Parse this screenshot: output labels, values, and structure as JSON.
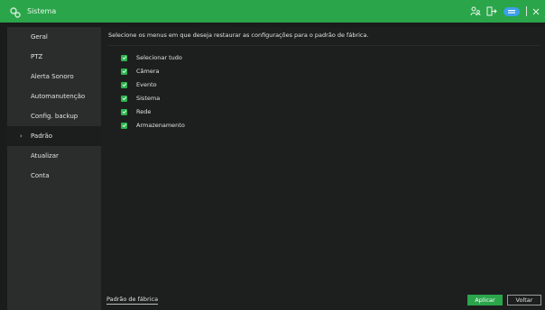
{
  "window": {
    "title": "Sistema"
  },
  "titlebar": {
    "icons": [
      "users-icon",
      "logout-icon",
      "cloud-icon",
      "close-icon"
    ]
  },
  "sidebar": {
    "items": [
      {
        "label": "Geral"
      },
      {
        "label": "PTZ"
      },
      {
        "label": "Alerta Sonoro"
      },
      {
        "label": "Automanutenção"
      },
      {
        "label": "Config. backup"
      },
      {
        "label": "Padrão",
        "active": true
      },
      {
        "label": "Atualizar"
      },
      {
        "label": "Conta"
      }
    ]
  },
  "main": {
    "description": "Selecione os menus em que deseja restaurar as configurações para o padrão de fábrica.",
    "options": [
      {
        "label": "Selecionar tudo",
        "checked": true
      },
      {
        "label": "Câmera",
        "checked": true
      },
      {
        "label": "Evento",
        "checked": true
      },
      {
        "label": "Sistema",
        "checked": true
      },
      {
        "label": "Rede",
        "checked": true
      },
      {
        "label": "Armazenamento",
        "checked": true
      }
    ],
    "factory_link": "Padrão de fábrica",
    "apply_label": "Aplicar",
    "back_label": "Voltar"
  },
  "colors": {
    "accent": "#2aa54a",
    "checkbox": "#2db34f",
    "sidebar_bg": "#2b2d2c",
    "content_bg": "#1d1f1e"
  }
}
